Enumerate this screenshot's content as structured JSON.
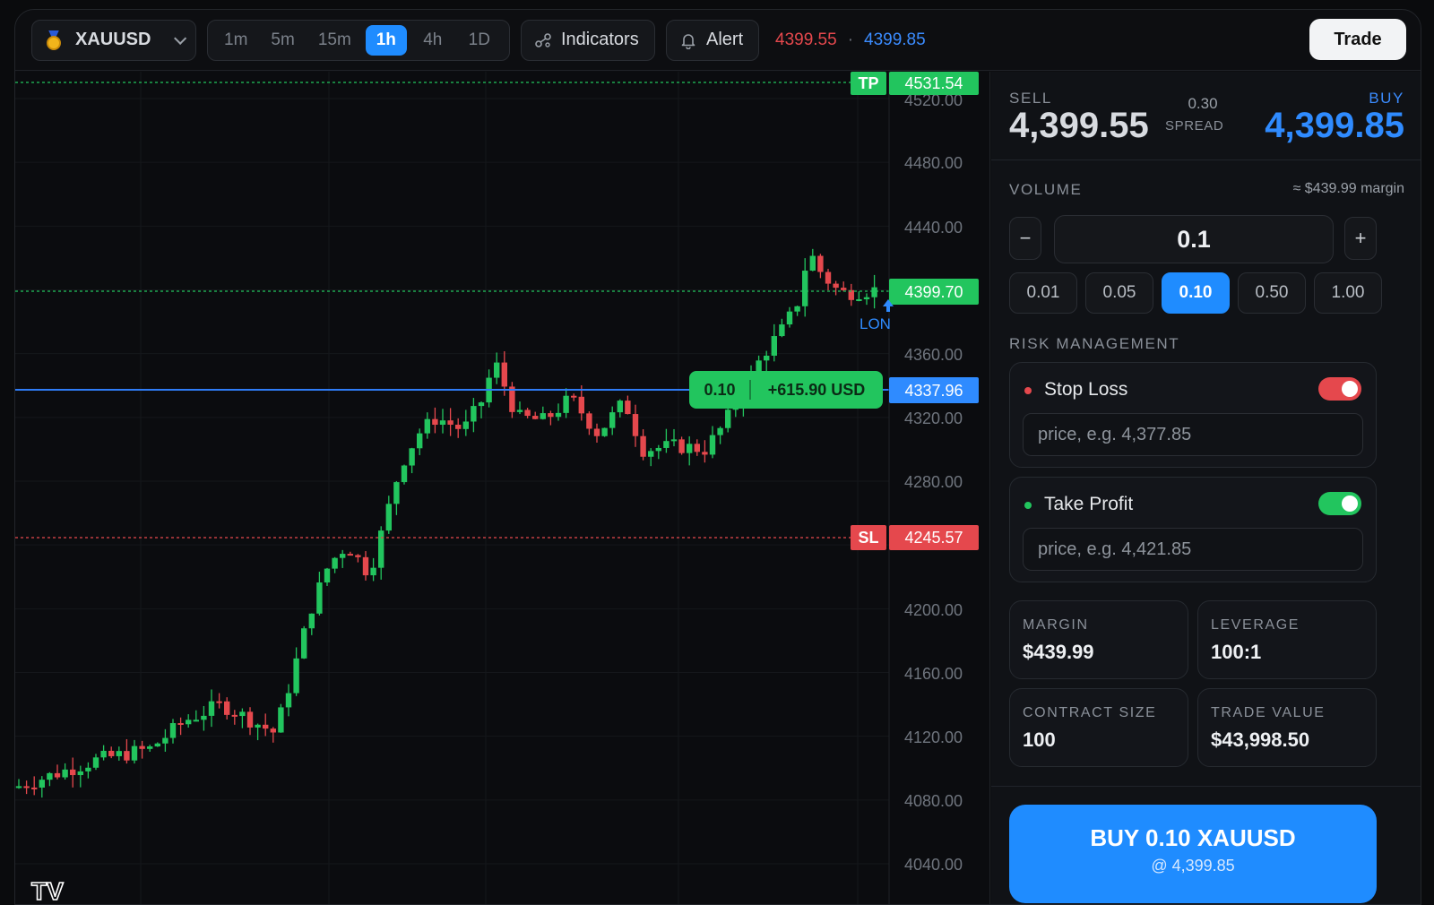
{
  "header": {
    "symbol": "XAUUSD",
    "timeframes": [
      {
        "label": "1m",
        "active": false
      },
      {
        "label": "5m",
        "active": false
      },
      {
        "label": "15m",
        "active": false
      },
      {
        "label": "1h",
        "active": true
      },
      {
        "label": "4h",
        "active": false
      },
      {
        "label": "1D",
        "active": false
      }
    ],
    "indicators_label": "Indicators",
    "alert_label": "Alert",
    "sell_quote": "4399.55",
    "separator": "·",
    "buy_quote": "4399.85",
    "trade_button": "Trade"
  },
  "chart": {
    "price_labels": [
      "4520.00",
      "4480.00",
      "4440.00",
      "4360.00",
      "4320.00",
      "4280.00",
      "4200.00",
      "4160.00",
      "4120.00",
      "4080.00",
      "4040.00"
    ],
    "tp": {
      "tag": "TP",
      "price": "4531.54"
    },
    "sl": {
      "tag": "SL",
      "price": "4245.57"
    },
    "current_price": "4399.70",
    "entry_price": "4337.96",
    "position": {
      "volume": "0.10",
      "pnl": "+615.90 USD"
    },
    "marker_label": "LON",
    "watermark": "TV"
  },
  "quote": {
    "sell_label": "SELL",
    "sell_price": "4,399.55",
    "spread_value": "0.30",
    "spread_label": "SPREAD",
    "buy_label": "BUY",
    "buy_price": "4,399.85"
  },
  "volume": {
    "label": "VOLUME",
    "margin_hint": "≈ $439.99 margin",
    "minus": "−",
    "plus": "+",
    "value": "0.1",
    "presets": [
      {
        "label": "0.01",
        "active": false
      },
      {
        "label": "0.05",
        "active": false
      },
      {
        "label": "0.10",
        "active": true
      },
      {
        "label": "0.50",
        "active": false
      },
      {
        "label": "1.00",
        "active": false
      }
    ]
  },
  "risk": {
    "label": "RISK MANAGEMENT",
    "stop_loss": {
      "title": "Stop Loss",
      "placeholder": "price, e.g. 4,377.85",
      "enabled": true,
      "color": "#e5484d"
    },
    "take_profit": {
      "title": "Take Profit",
      "placeholder": "price, e.g. 4,421.85",
      "enabled": true,
      "color": "#22c55e"
    }
  },
  "stats": [
    {
      "key": "MARGIN",
      "value": "$439.99"
    },
    {
      "key": "LEVERAGE",
      "value": "100:1"
    },
    {
      "key": "CONTRACT SIZE",
      "value": "100"
    },
    {
      "key": "TRADE VALUE",
      "value": "$43,998.50"
    }
  ],
  "order": {
    "button_label": "BUY 0.10 XAUUSD",
    "sub_label": "@ 4,399.85"
  },
  "colors": {
    "up": "#22c55e",
    "down": "#e5484d",
    "accent": "#1f8cff"
  }
}
